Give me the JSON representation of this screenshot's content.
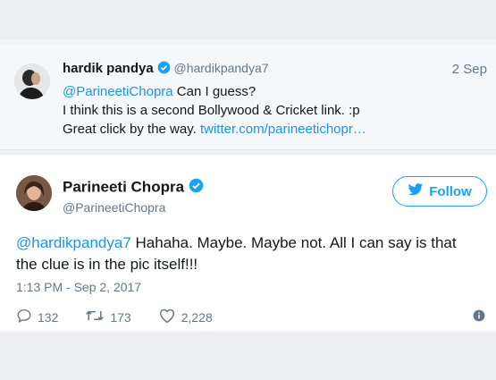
{
  "reply_tweet": {
    "name": "hardik pandya",
    "handle": "@hardikpandya7",
    "date": "2 Sep",
    "line1_mention": "@ParineetiChopra",
    "line1_text": " Can I guess?",
    "line2": "I think this is a second Bollywood & Cricket link. :p",
    "line3_text": "Great click by the way. ",
    "line3_link": "twitter.com/parineetichopr…"
  },
  "main_tweet": {
    "name": "Parineeti Chopra",
    "handle": "@ParineetiChopra",
    "follow_label": "Follow",
    "mention": "@hardikpandya7",
    "text": " Hahaha. Maybe. Maybe not. All I can say is that the clue is in the pic itself!!!",
    "timestamp": "1:13 PM - Sep 2, 2017",
    "replies": "132",
    "retweets": "173",
    "likes": "2,228"
  },
  "colors": {
    "accent": "#1da1f2",
    "link": "#1b95e0",
    "muted": "#657786"
  },
  "icons": [
    "verified-icon",
    "twitter-bird-icon",
    "reply-icon",
    "retweet-icon",
    "like-icon",
    "info-icon"
  ]
}
